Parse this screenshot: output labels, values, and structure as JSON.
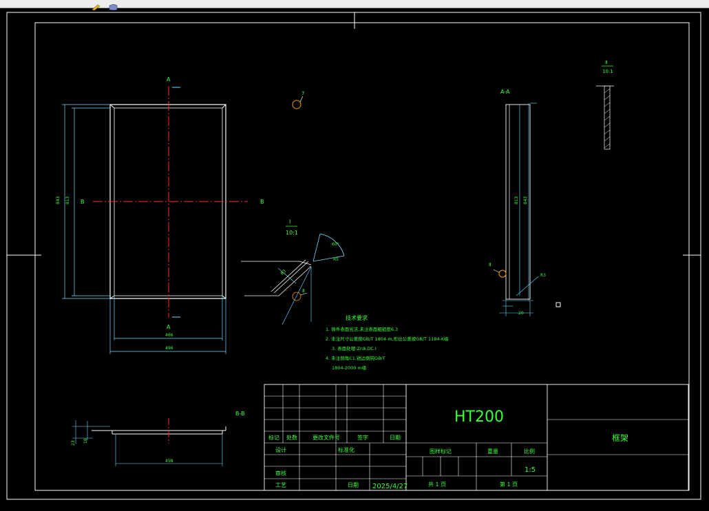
{
  "toolbar": {
    "icons": [
      "pencil-tool-icon",
      "cube-tool-icon"
    ]
  },
  "drawing": {
    "section_aa": "A-A",
    "section_bb": "B-B",
    "cut_a": "A",
    "cut_b": "B",
    "detail_c": "Ⅰ",
    "detail_d": "Ⅱ",
    "detail_scale": "10:1",
    "balloon_7": "7",
    "dims": {
      "front_outer_h": "843",
      "front_inner_h": "813",
      "front_w1": "466",
      "front_w2": "496",
      "aa_inner": "813",
      "aa_outer": "843",
      "aa_r": "R3",
      "aa_bottom": "20",
      "bb_h1": "23",
      "bb_h2": "18",
      "bb_w": "458",
      "detail_angle": "60°",
      "detail_r": "R5",
      "detail_len": "R3"
    },
    "tech_req": {
      "title": "技术要求",
      "lines": [
        "1. 铸件表面光洁,未注表面粗糙度6.3",
        "2. 未注尺寸公差按GB/T 1804-m,形位公差按GB/T 1184-K级",
        "3. 表面处理:Zn8.DC.I",
        "4. 未注倒角C1,锐边倒钝GB/T",
        "1804-2000 m级"
      ]
    }
  },
  "title_block": {
    "material": "HT200",
    "part_name": "框架",
    "row_labels": {
      "mark": "标记",
      "count": "处数",
      "doc_no": "更改文件号",
      "sign": "签字",
      "date": "日期",
      "design": "设计",
      "standard": "标准化",
      "review": "审核",
      "process": "工艺",
      "date2": "日期"
    },
    "date_value": "2025/4/27",
    "stage_label": "图样标记",
    "weight_label": "重量",
    "scale_label": "比例",
    "scale_value": "1:5",
    "sheets_total": "共 1 页",
    "sheet_no": "第 1 页"
  }
}
